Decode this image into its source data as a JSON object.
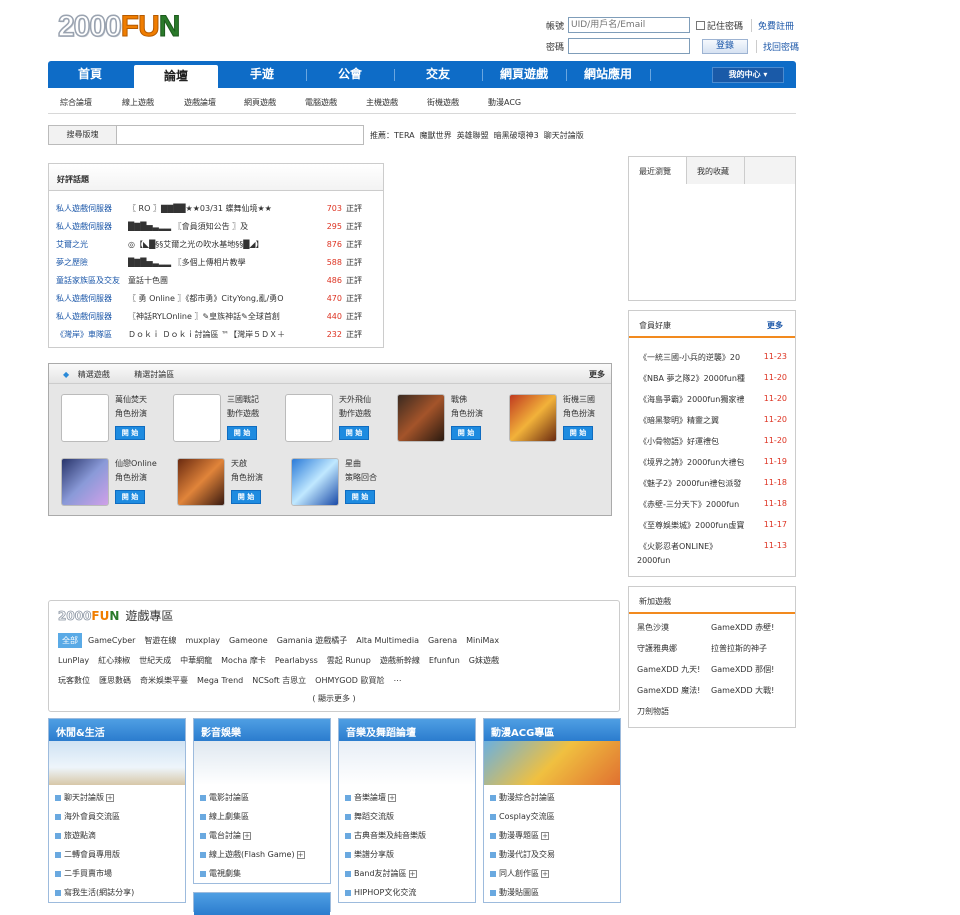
{
  "logo": {
    "part1": "2000",
    "part2": "FU",
    "part3": "N"
  },
  "login": {
    "account_label": "帳號",
    "account_placeholder": "UID/用戶名/Email",
    "remember_label": "記住密碼",
    "register_link": "免費註冊",
    "password_label": "密碼",
    "login_button": "登錄",
    "forgot_link": "找回密碼"
  },
  "nav": {
    "items": [
      "首頁",
      "論壇",
      "手遊",
      "公會",
      "交友",
      "網頁遊戲",
      "網站應用"
    ],
    "my_center": "我的中心 ▾"
  },
  "subnav": [
    "綜合論壇",
    "線上遊戲",
    "遊戲論壇",
    "網頁遊戲",
    "電腦遊戲",
    "主機遊戲",
    "街機遊戲",
    "動漫ACG"
  ],
  "search": {
    "label": "搜尋版塊",
    "recommend_label": "推薦：",
    "recommend": [
      "TERA",
      "魔獸世界",
      "英雄聯盟",
      "暗黑破壞神3",
      "聊天討論版"
    ]
  },
  "hot_topics": {
    "title": "好評話題",
    "rows": [
      {
        "forum": "私人遊戲伺服器 ",
        "title": "〖 RO 〗▇▇██★★03/31 蝶舞仙境★★",
        "count": "703",
        "suffix": "正評"
      },
      {
        "forum": "私人遊戲伺服器 ",
        "title": "█▇█▅▃▂▂ 〖會員須知公告 〗及",
        "count": "295",
        "suffix": "正評"
      },
      {
        "forum": "艾爾之光",
        "title": "◎【◣█§§艾爾之光の吹水基地§§█◢】",
        "count": "876",
        "suffix": "正評"
      },
      {
        "forum": "夢之歷險",
        "title": "█▇█▅▃▂▂ 〖多個上傳相片教學",
        "count": "588",
        "suffix": "正評"
      },
      {
        "forum": "童話家族區及交友",
        "title": "童話十色團",
        "count": "486",
        "suffix": "正評"
      },
      {
        "forum": "私人遊戲伺服器 ",
        "title": "〖 勇 Online 〗《都市勇》CityYong,亂/勇O",
        "count": "470",
        "suffix": "正評"
      },
      {
        "forum": "私人遊戲伺服器 ",
        "title": "〖神話RYLOnline 〗✎皇族神話✎全球首創",
        "count": "440",
        "suffix": "正評"
      },
      {
        "forum": "《灣岸》車隊區",
        "title": "Ｄｏｋｉ Ｄｏｋｉ討論區 ™【灣岸５ＤＸ＋",
        "count": "232",
        "suffix": "正評"
      }
    ]
  },
  "featured": {
    "tab1": "精選遊戲",
    "tab2": "精選討論區",
    "more": "更多",
    "start_label": "開 始",
    "games": [
      {
        "name": "萬仙焚天",
        "type": "角色扮演"
      },
      {
        "name": "三國戰記",
        "type": "動作遊戲"
      },
      {
        "name": "天外飛仙",
        "type": "動作遊戲"
      },
      {
        "name": "戰佛",
        "type": "角色扮演"
      },
      {
        "name": "街機三國",
        "type": "角色扮演"
      },
      {
        "name": "仙戀Online",
        "type": "角色扮演"
      },
      {
        "name": "天啟",
        "type": "角色扮演"
      },
      {
        "name": "星曲",
        "type": "策略回合"
      }
    ]
  },
  "recent": {
    "tab1": "最近瀏覽",
    "tab2": "我的收藏"
  },
  "member_perks": {
    "title": "會員好康",
    "more": "更多",
    "items": [
      {
        "text": "《一統三國-小兵的逆襲》20",
        "date": "11-23"
      },
      {
        "text": "《NBA 夢之隊2》2000fun種",
        "date": "11-20"
      },
      {
        "text": "《海島爭霸》2000fun獨家禮",
        "date": "11-20"
      },
      {
        "text": "《暗黑黎明》精靈之翼",
        "date": "11-20"
      },
      {
        "text": "《小骨物語》好運禮包",
        "date": "11-20"
      },
      {
        "text": "《境界之詩》2000fun大禮包",
        "date": "11-19"
      },
      {
        "text": "《魅子2》2000fun禮包派發",
        "date": "11-18"
      },
      {
        "text": "《赤壁-三分天下》2000fun",
        "date": "11-18"
      },
      {
        "text": "《至尊娛樂城》2000fun虛寶",
        "date": "11-17"
      },
      {
        "text": "《火影忍者ONLINE》",
        "date": "11-13"
      }
    ],
    "wrap_line": "2000fun"
  },
  "new_games": {
    "title": "新加遊戲",
    "items": [
      "黑色沙漠",
      "GameXDD 赤壁!",
      "守護雅典娜",
      "拉普拉斯的神子",
      "GameXDD 九天!",
      "GameXDD 那個!",
      "GameXDD 魔法!",
      "GameXDD 大戰!",
      "刀劍物語"
    ]
  },
  "zone": {
    "title_suffix": "遊戲專區",
    "publishers": [
      "全部",
      "GameCyber",
      "智遊在線",
      "muxplay",
      "Gameone",
      "Gamania 遊戲橘子",
      "Alta Multimedia",
      "Garena",
      "MiniMax",
      "LunPlay",
      "紅心辣椒",
      "世紀天成",
      "中華網龍",
      "Mocha 摩卡",
      "Pearlabyss",
      "雲起 Runup",
      "遊戲新幹線",
      "Efunfun",
      "G妹遊戲",
      "玩客數位",
      "匯思數碼",
      "奇米娛樂平臺",
      "Mega Trend",
      "NCSoft 吉恩立",
      "OHMYGOD 歐買尬",
      "⋯"
    ],
    "show_more": "( 顯示更多 )"
  },
  "categories": [
    {
      "title": "休閒&生活",
      "items": [
        {
          "t": "聊天討論版",
          "p": true
        },
        {
          "t": "海外會員交流區"
        },
        {
          "t": "旅遊點滴"
        },
        {
          "t": "二轉會員專用版"
        },
        {
          "t": "二手買賣市場"
        },
        {
          "t": "寫我生活(網誌分享)"
        }
      ]
    },
    {
      "title": "影音娛樂",
      "items": [
        {
          "t": "電影討論區"
        },
        {
          "t": "線上劇集區"
        },
        {
          "t": "電台討論",
          "p": true
        },
        {
          "t": "線上遊戲(Flash Game)",
          "p": true
        },
        {
          "t": "電視劇集"
        }
      ]
    },
    {
      "title": "音樂及舞蹈論壇",
      "items": [
        {
          "t": "音樂論壇",
          "p": true
        },
        {
          "t": "舞蹈交流版"
        },
        {
          "t": "古典音樂及純音樂版"
        },
        {
          "t": "樂譜分享版"
        },
        {
          "t": "Band友討論區",
          "p": true
        },
        {
          "t": "HIPHOP文化交流"
        }
      ]
    },
    {
      "title": "動漫ACG專區",
      "items": [
        {
          "t": "動漫綜合討論區"
        },
        {
          "t": "Cosplay交流區"
        },
        {
          "t": "動漫專題區",
          "p": true
        },
        {
          "t": "動漫代訂及交易"
        },
        {
          "t": "同人創作區",
          "p": true
        },
        {
          "t": "動漫貼圖區"
        }
      ]
    }
  ]
}
